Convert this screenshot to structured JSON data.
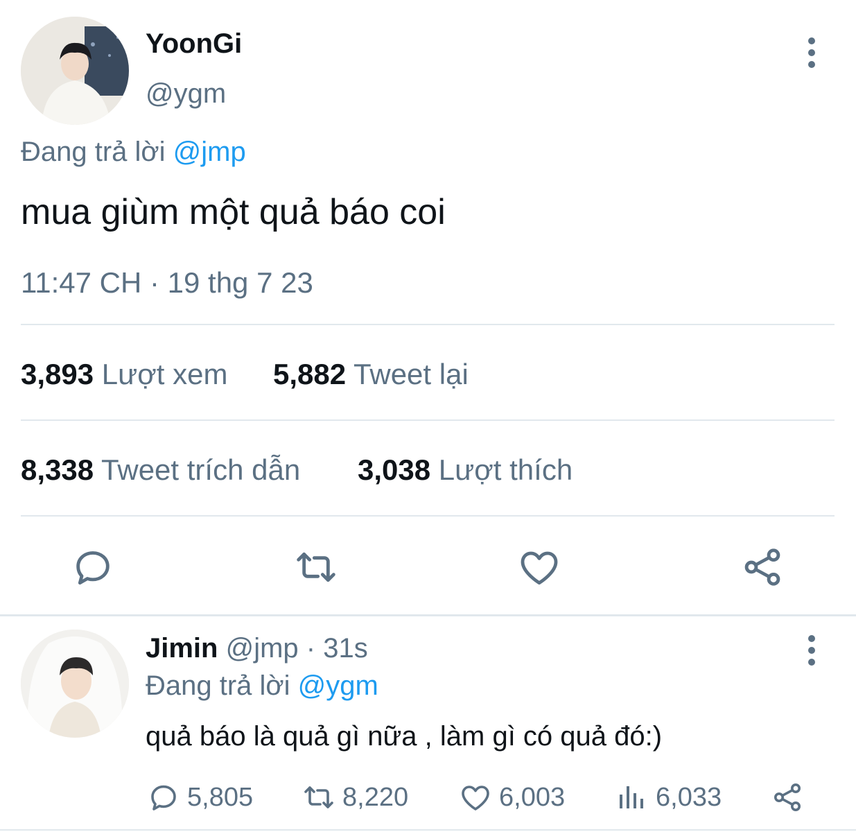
{
  "main_tweet": {
    "author_name": "YoonGi",
    "author_handle": "@ygm",
    "replying_prefix": "Đang trả lời",
    "replying_to": "@jmp",
    "text": "mua giùm một quả báo coi",
    "timestamp": "11:47 CH · 19 thg 7 23",
    "stats": {
      "views_count": "3,893",
      "views_label": "Lượt xem",
      "retweets_count": "5,882",
      "retweets_label": "Tweet lại",
      "quotes_count": "8,338",
      "quotes_label": "Tweet trích dẫn",
      "likes_count": "3,038",
      "likes_label": "Lượt thích"
    },
    "actions": [
      "reply-icon",
      "retweet-icon",
      "like-icon",
      "share-icon"
    ]
  },
  "reply_tweet": {
    "author_name": "Jimin",
    "author_handle": "@jmp",
    "time_ago": "· 31s",
    "replying_prefix": "Đang trả lời",
    "replying_to": "@ygm",
    "text": "quả báo là quả gì nữa , làm gì có quả đó:)",
    "counts": {
      "replies": "5,805",
      "retweets": "8,220",
      "likes": "6,003",
      "views": "6,033"
    }
  },
  "colors": {
    "text": "#0f1419",
    "secondary": "#5b7083",
    "link": "#1d9bf0",
    "divider": "#e1e8ed"
  }
}
